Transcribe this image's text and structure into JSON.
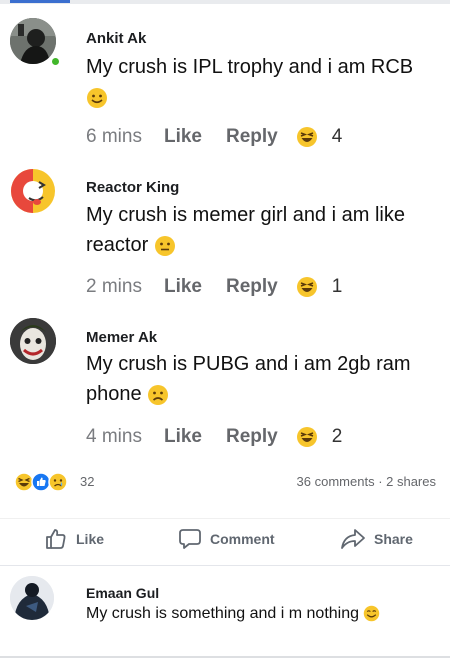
{
  "comments": [
    {
      "name": "Ankit Ak",
      "text": "My crush is IPL trophy and i am RCB",
      "time": "6 mins",
      "like_label": "Like",
      "reply_label": "Reply",
      "reaction_count": "4",
      "online": true,
      "avatar_icon": "dark-profile-photo"
    },
    {
      "name": "Reactor King",
      "text": "My crush is memer girl and i am like reactor",
      "time": "2 mins",
      "like_label": "Like",
      "reply_label": "Reply",
      "reaction_count": "1",
      "avatar_icon": "winking-tongue-emoji"
    },
    {
      "name": "Memer Ak",
      "text": "My crush is PUBG and i am 2gb ram phone",
      "time": "4 mins",
      "like_label": "Like",
      "reply_label": "Reply",
      "reaction_count": "2",
      "avatar_icon": "joker-face"
    }
  ],
  "post_summary": {
    "reactions_count": "32",
    "comments_shares": "36 comments · 2 shares"
  },
  "actions": {
    "like": "Like",
    "comment": "Comment",
    "share": "Share"
  },
  "latest_comment": {
    "name": "Emaan Gul",
    "text": "My crush  is something and i m nothing"
  },
  "colors": {
    "accent": "#3b6fcf",
    "online": "#42b72a",
    "emoji_yellow": "#f7c52b",
    "muted_text": "#65676b"
  }
}
